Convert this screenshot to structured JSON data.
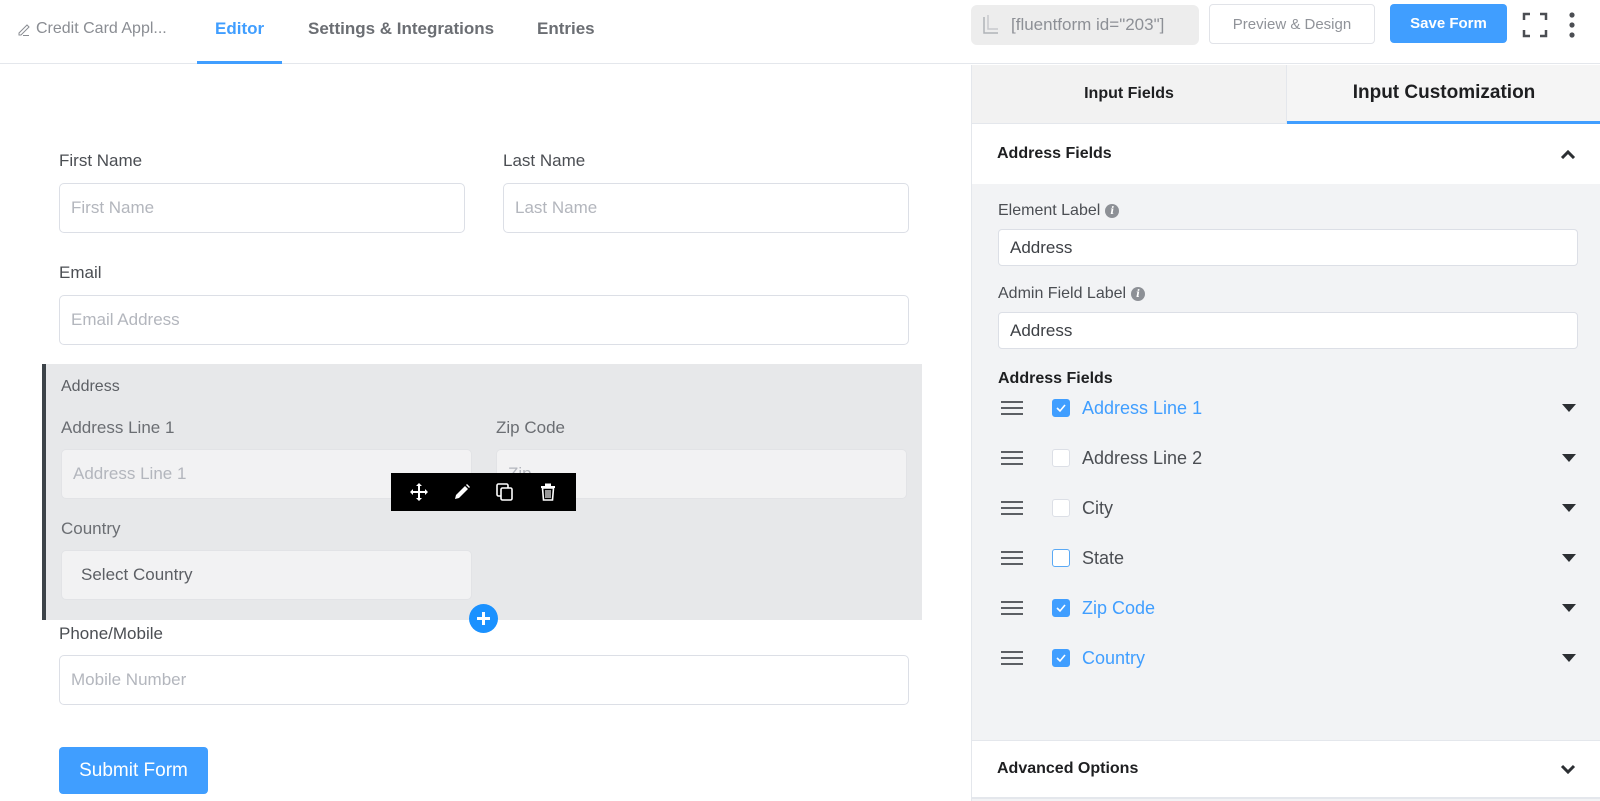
{
  "topbar": {
    "form_title": "Credit Card Appl...",
    "tabs": [
      {
        "label": "Editor",
        "active": true
      },
      {
        "label": "Settings & Integrations",
        "active": false
      },
      {
        "label": "Entries",
        "active": false
      }
    ],
    "shortcode": "[fluentform id=\"203\"]",
    "preview_label": "Preview & Design",
    "save_label": "Save Form"
  },
  "editor": {
    "first_name": {
      "label": "First Name",
      "placeholder": "First Name"
    },
    "last_name": {
      "label": "Last Name",
      "placeholder": "Last Name"
    },
    "email": {
      "label": "Email",
      "placeholder": "Email Address"
    },
    "address": {
      "title": "Address",
      "line1": {
        "label": "Address Line 1",
        "placeholder": "Address Line 1"
      },
      "zip": {
        "label": "Zip Code",
        "placeholder": "Zip"
      },
      "country": {
        "label": "Country",
        "placeholder": "Select Country"
      }
    },
    "phone": {
      "label": "Phone/Mobile",
      "placeholder": "Mobile Number"
    },
    "submit_label": "Submit Form"
  },
  "panel": {
    "tabs": [
      {
        "label": "Input Fields",
        "active": false
      },
      {
        "label": "Input Customization",
        "active": true
      }
    ],
    "section_title": "Address Fields",
    "element_label": {
      "label": "Element Label",
      "value": "Address"
    },
    "admin_field_label": {
      "label": "Admin Field Label",
      "value": "Address"
    },
    "address_fields_heading": "Address Fields",
    "address_fields": [
      {
        "label": "Address Line 1",
        "checked": true
      },
      {
        "label": "Address Line 2",
        "checked": false
      },
      {
        "label": "City",
        "checked": false
      },
      {
        "label": "State",
        "checked": false
      },
      {
        "label": "Zip Code",
        "checked": true
      },
      {
        "label": "Country",
        "checked": true
      }
    ],
    "advanced_options": "Advanced Options"
  },
  "colors": {
    "accent": "#409eff",
    "toolbar": "#000000",
    "address_block_bg": "#e7e8ea"
  }
}
